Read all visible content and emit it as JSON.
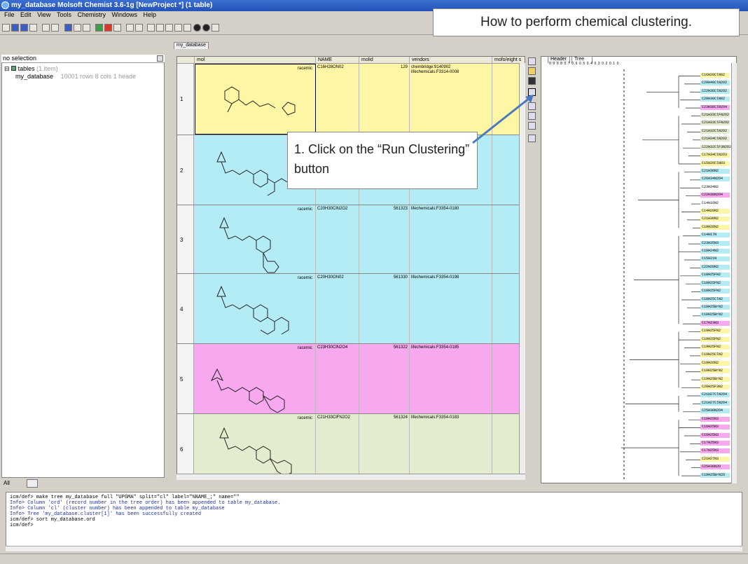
{
  "window": {
    "title": "my_database Molsoft Chemist 3.6-1g [NewProject *] (1 table)"
  },
  "menu": [
    "File",
    "Edit",
    "View",
    "Tools",
    "Chemistry",
    "Windows",
    "Help"
  ],
  "banner": "How to perform chemical clustering.",
  "left": {
    "selection": "no selection",
    "tree": {
      "tables_label": "tables",
      "tables_count": "(1 item)",
      "db_name": "my_database",
      "db_info": "10001 rows 8 cols 1 heade"
    },
    "footer_label": "All"
  },
  "tab": "my_database",
  "grid": {
    "headers": [
      "mol",
      "NAME",
      "molid",
      "vendors",
      "mofo/eight s"
    ],
    "rows": [
      {
        "num": "1",
        "label": "racemic",
        "name": "C16H28ON02",
        "molid": "129",
        "vendor": "chembridge:9140902 lifechemicals:F3314-0008",
        "w": "30",
        "color": "#fdf6a4"
      },
      {
        "num": "2",
        "label": "",
        "name": "",
        "molid": "",
        "vendor": "",
        "w": "50",
        "color": "#b4ecf6"
      },
      {
        "num": "3",
        "label": "racemic",
        "name": "C20H30ClN2O2",
        "molid": "561323",
        "vendor": "lifechemicals:F3354-0180",
        "w": "43",
        "color": "#b4ecf6"
      },
      {
        "num": "4",
        "label": "racemic",
        "name": "C20H30ON02",
        "molid": "561330",
        "vendor": "lifechemicals:F3354-0198",
        "w": "35",
        "color": "#b4ecf6"
      },
      {
        "num": "5",
        "label": "racemic",
        "name": "C23H30ClN2O4",
        "molid": "561322",
        "vendor": "lifechemicals:F3354-0185",
        "w": "47",
        "color": "#f7a8ee"
      },
      {
        "num": "6",
        "label": "racemic",
        "name": "C21H33ClFN2O2",
        "molid": "561324",
        "vendor": "lifechemicals:F3354-0183",
        "w": "43",
        "color": "#e4ecd0"
      }
    ]
  },
  "callout": "1. Click on the “Run Clustering” button",
  "tree_panel": {
    "tabs": [
      "Header",
      "Tree"
    ],
    "scale": "0.9 0.8 0.7 0.6 0.5 0.4 0.3 0.2 0.1 0.",
    "leaves": [
      {
        "t": "C16H28ClN02",
        "c": "#fdf6a4"
      },
      {
        "t": "C20H40ClN2O2",
        "c": "#b4ecf6"
      },
      {
        "t": "C22H36ClN2O2",
        "c": "#b4ecf6"
      },
      {
        "t": "C20H30ClN02",
        "c": "#b4ecf6"
      },
      {
        "t": "C23H36ClN2O4",
        "c": "#f7a8ee"
      },
      {
        "t": "C21H33ClFN2O2",
        "c": "#e4ecd0"
      },
      {
        "t": "C21H33ClFN2O2",
        "c": "#e4ecd0"
      },
      {
        "t": "C21H32ClN2O2",
        "c": "#e4ecd0"
      },
      {
        "t": "C21H34ClN2O2",
        "c": "#e4ecd0"
      },
      {
        "t": "C22H32ClF3N2O2",
        "c": "#e4ecd0"
      },
      {
        "t": "C17H34ClN2O3",
        "c": "#fdf6a4"
      },
      {
        "t": "C15H26ClN03",
        "c": "#fdf6a4"
      },
      {
        "t": "C21H30N2",
        "c": "#b4ecf6"
      },
      {
        "t": "C26H34N2O4",
        "c": "#b4ecf6"
      },
      {
        "t": "C23H34N2",
        "c": "#ffffff"
      },
      {
        "t": "C22H30N2O4",
        "c": "#f7a8ee"
      },
      {
        "t": "C14H16N2",
        "c": "#ffffff"
      },
      {
        "t": "C14H20N2",
        "c": "#fdf6a4"
      },
      {
        "t": "C21H30N2",
        "c": "#fdf6a4"
      },
      {
        "t": "C19H28N2",
        "c": "#fdf6a4"
      },
      {
        "t": "C14H17N",
        "c": "#b4ecf6"
      },
      {
        "t": "C23H35N3",
        "c": "#b4ecf6"
      },
      {
        "t": "C18H24N2",
        "c": "#b4ecf6"
      },
      {
        "t": "C15H21N",
        "c": "#b4ecf6"
      },
      {
        "t": "C22H28N2",
        "c": "#b4ecf6"
      },
      {
        "t": "C18H25FN2",
        "c": "#b4ecf6"
      },
      {
        "t": "C18H25FN2",
        "c": "#b4ecf6"
      },
      {
        "t": "C18H25FN2",
        "c": "#b4ecf6"
      },
      {
        "t": "C18H25ClN2",
        "c": "#b4ecf6"
      },
      {
        "t": "C18H25BrN2",
        "c": "#b4ecf6"
      },
      {
        "t": "C18H25BrN2",
        "c": "#b4ecf6"
      },
      {
        "t": "C17H23N3",
        "c": "#f7a8ee"
      },
      {
        "t": "C19H25FN2",
        "c": "#fdf6a4"
      },
      {
        "t": "C19H25FN2",
        "c": "#fdf6a4"
      },
      {
        "t": "C19H25FN2",
        "c": "#fdf6a4"
      },
      {
        "t": "C19H25ClN2",
        "c": "#fdf6a4"
      },
      {
        "t": "C19H26N2",
        "c": "#fdf6a4"
      },
      {
        "t": "C19H25BrN2",
        "c": "#fdf6a4"
      },
      {
        "t": "C19H25BrN2",
        "c": "#fdf6a4"
      },
      {
        "t": "C20H25F3N2",
        "c": "#fdf6a4"
      },
      {
        "t": "C21H27ClN2O4",
        "c": "#b4ecf6"
      },
      {
        "t": "C21H27ClN2O4",
        "c": "#b4ecf6"
      },
      {
        "t": "C25H30N2O4",
        "c": "#b4ecf6"
      },
      {
        "t": "C18H25N3",
        "c": "#f7a8ee"
      },
      {
        "t": "C16H25N3",
        "c": "#f7a8ee"
      },
      {
        "t": "C16H25N3",
        "c": "#f7a8ee"
      },
      {
        "t": "C17H25N3",
        "c": "#f7a8ee"
      },
      {
        "t": "C17H25N3",
        "c": "#f7a8ee"
      },
      {
        "t": "C21H27N3",
        "c": "#fdf6a4"
      },
      {
        "t": "C25H30N2O",
        "c": "#f7a8ee"
      },
      {
        "t": "C19H25BrN2O",
        "c": "#b4ecf6"
      }
    ]
  },
  "console": [
    {
      "t": "icm/def> make tree my_database full \"UPGMA\" split=\"cl\" label=\"%NAME_;\" name=\"\"",
      "k": "cmd"
    },
    {
      "t": "  Info> Column 'ord' (record number in the tree order) has been appended to table my_database.",
      "k": "info"
    },
    {
      "t": "  Info> Column 'cl' (cluster number) has been appended to table my_database",
      "k": "info"
    },
    {
      "t": "  Info> Tree 'my_database.cluster[1]' has been successfully created",
      "k": "info"
    },
    {
      "t": "icm/def> sort my_database.ord",
      "k": "cmd"
    },
    {
      "t": "icm/def> ",
      "k": "cmd"
    }
  ],
  "colors": {
    "yellow": "#fdf6a4",
    "cyan": "#b4ecf6",
    "magenta": "#f7a8ee",
    "green": "#e4ecd0",
    "titlebar": "#2452b8",
    "callout_arrow": "#4a78c0"
  }
}
